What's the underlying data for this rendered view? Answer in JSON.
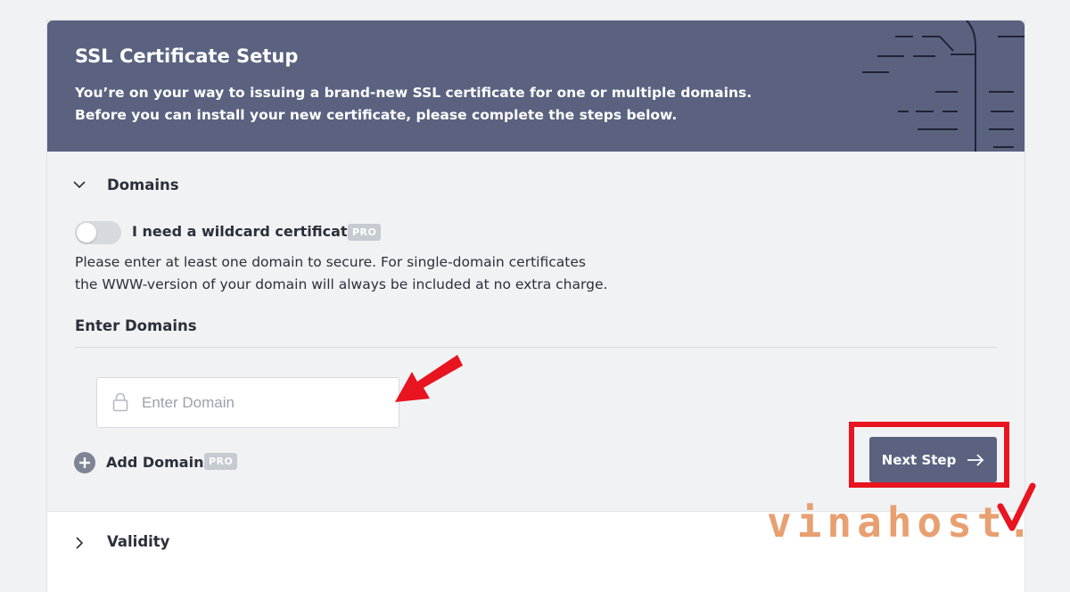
{
  "header": {
    "title": "SSL Certificate Setup",
    "subtitle_line1": "You’re on your way to issuing a brand-new SSL certificate for one or multiple domains.",
    "subtitle_line2": "Before you can install your new certificate, please complete the steps below."
  },
  "domains_section": {
    "label": "Domains",
    "expanded": true,
    "wildcard": {
      "label": "I need a wildcard certificate",
      "badge": "PRO",
      "enabled": false
    },
    "help_line1": "Please enter at least one domain to secure. For single-domain certificates",
    "help_line2": "the WWW-version of your domain will always be included at no extra charge.",
    "enter_title": "Enter Domains",
    "input": {
      "placeholder": "Enter Domain",
      "value": ""
    },
    "add_domain": {
      "label": "Add Domain",
      "badge": "PRO"
    }
  },
  "next_button": {
    "label": "Next Step",
    "icon": "arrow-right-icon"
  },
  "validity_section": {
    "label": "Validity",
    "expanded": false
  },
  "watermark": {
    "text": "vinahost."
  },
  "colors": {
    "header_bg": "#5a6280",
    "page_bg": "#f1f2f4",
    "annotation_red": "#e8141f",
    "watermark_orange": "#e8a070"
  }
}
